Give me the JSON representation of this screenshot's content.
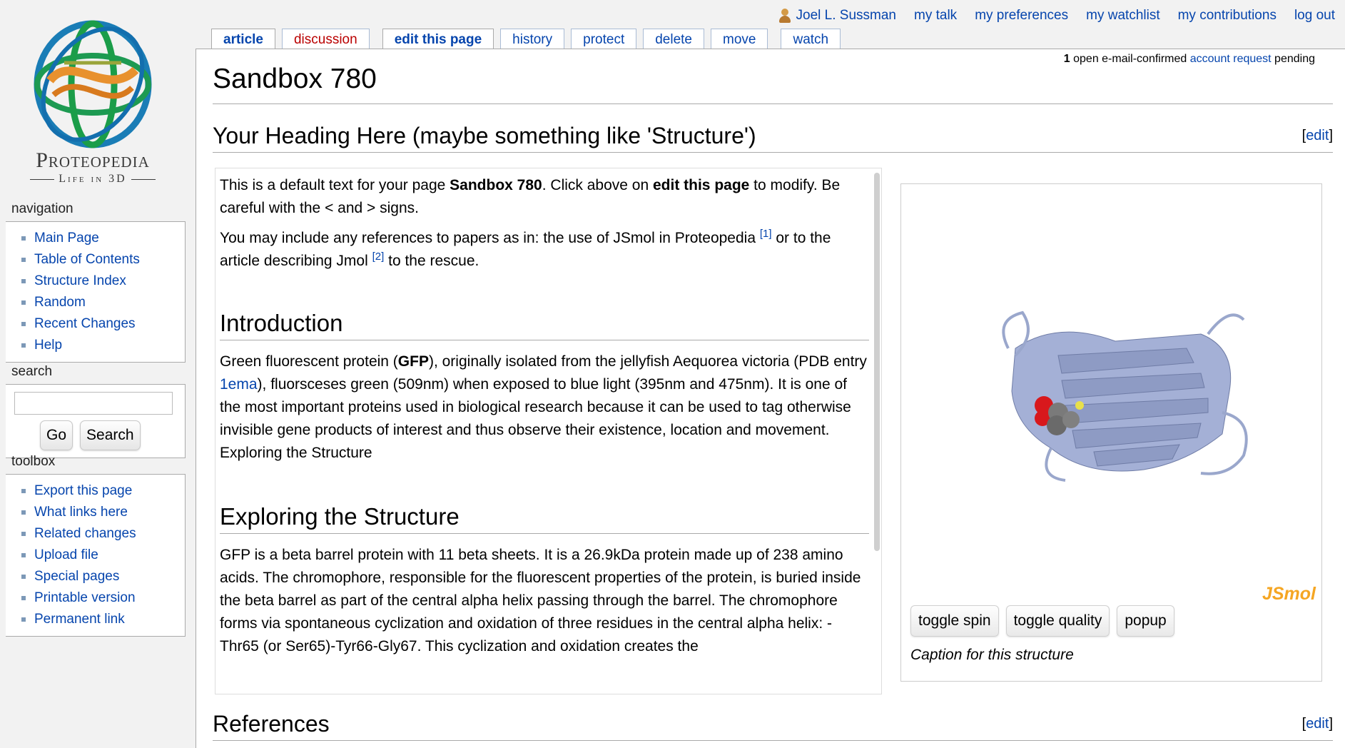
{
  "personal": {
    "user": "Joel L. Sussman",
    "links": [
      "my talk",
      "my preferences",
      "my watchlist",
      "my contributions",
      "log out"
    ]
  },
  "logo": {
    "name": "Proteopedia",
    "tagline": "Life in 3D"
  },
  "sidebar": {
    "navigation": {
      "title": "navigation",
      "items": [
        "Main Page",
        "Table of Contents",
        "Structure Index",
        "Random",
        "Recent Changes",
        "Help"
      ]
    },
    "search": {
      "title": "search",
      "go": "Go",
      "search": "Search",
      "value": ""
    },
    "toolbox": {
      "title": "toolbox",
      "items": [
        "Export this page",
        "What links here",
        "Related changes",
        "Upload file",
        "Special pages",
        "Printable version",
        "Permanent link"
      ]
    }
  },
  "tabs": [
    "article",
    "discussion",
    "edit this page",
    "history",
    "protect",
    "delete",
    "move",
    "watch"
  ],
  "notice": {
    "count": "1",
    "pre": " open e-mail-confirmed ",
    "link": "account request",
    "post": " pending"
  },
  "page": {
    "title": "Sandbox 780",
    "heading": "Your Heading Here (maybe something like 'Structure')",
    "edit": "edit",
    "p1": {
      "a": "This is a default text for your page ",
      "b": "Sandbox 780",
      "c": ". Click above on ",
      "d": "edit this page",
      "e": " to modify. Be careful with the < and > signs."
    },
    "p2": {
      "a": "You may include any references to papers as in: the use of JSmol in Proteopedia ",
      "ref1": "[1]",
      "b": " or to the article describing Jmol ",
      "ref2": "[2]",
      "c": " to the rescue."
    },
    "intro_title": "Introduction",
    "intro": {
      "a": "Green fluorescent protein (",
      "b": "GFP",
      "c": "), originally isolated from the jellyfish Aequorea victoria (PDB entry ",
      "link": "1ema",
      "d": "), fluorsceses green (509nm) when exposed to blue light (395nm and 475nm). It is one of the most important proteins used in biological research because it can be used to tag otherwise invisible gene products of interest and thus observe their existence, location and movement. Exploring the Structure"
    },
    "explore_title": "Exploring the Structure",
    "explore": "GFP is a beta barrel protein with 11 beta sheets. It is a 26.9kDa protein made up of 238 amino acids. The chromophore, responsible for the fluorescent properties of the protein, is buried inside the beta barrel as part of the central alpha helix passing through the barrel. The chromophore forms via spontaneous cyclization and oxidation of three residues in the central alpha helix: -Thr65 (or Ser65)-Tyr66-Gly67. This cyclization and oxidation creates the",
    "references": "References"
  },
  "jsmol": {
    "logo": "JSmol",
    "buttons": [
      "toggle spin",
      "toggle quality",
      "popup"
    ],
    "caption": "Caption for this structure"
  },
  "colors": {
    "link": "#0645ad",
    "new_link": "#ba0000",
    "jsmol": "#f5a623"
  }
}
